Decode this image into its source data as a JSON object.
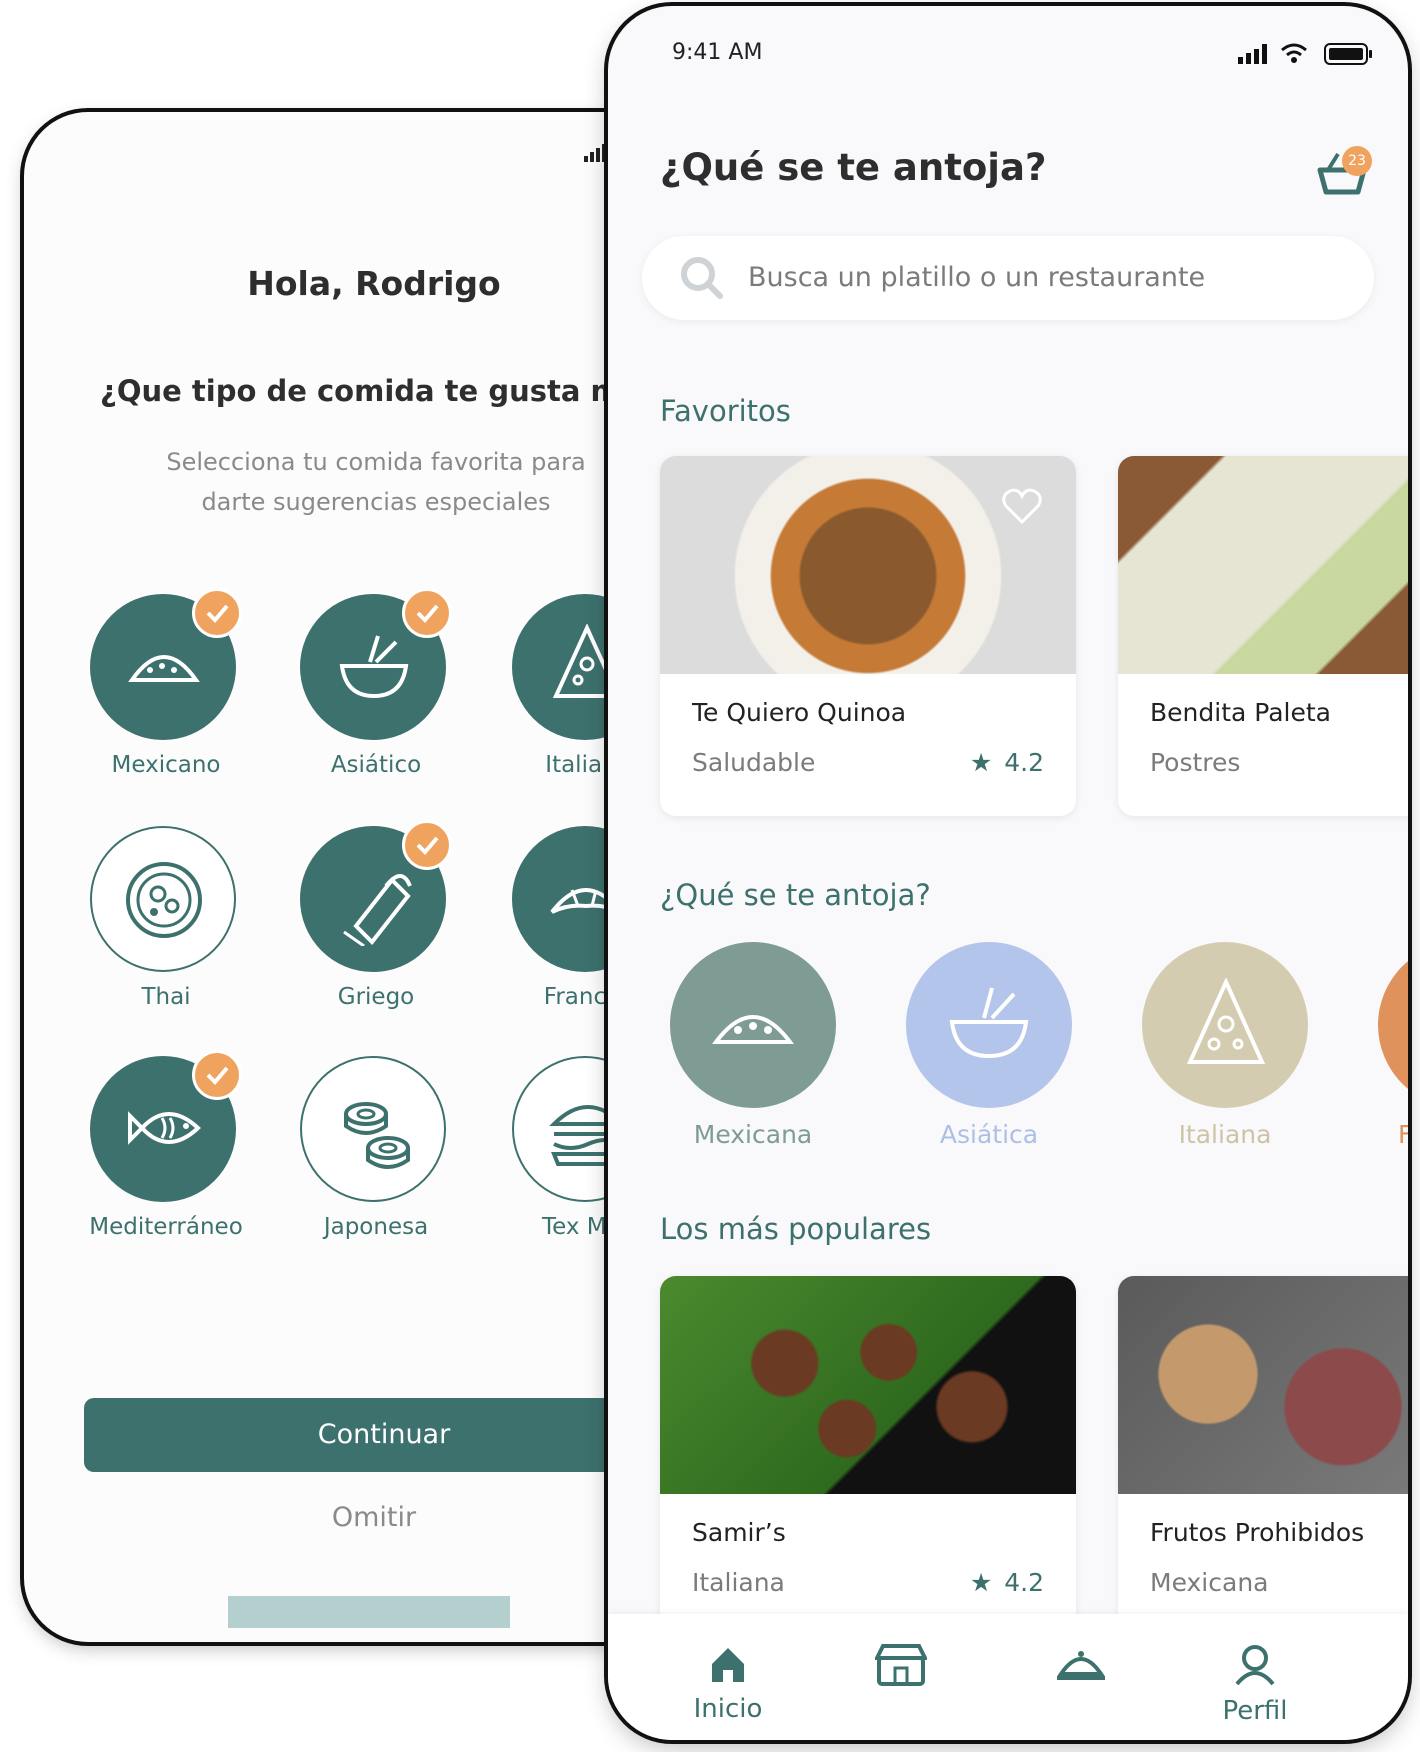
{
  "onboarding": {
    "greeting": "Hola, Rodrigo",
    "question": "¿Que tipo de comida te gusta más?",
    "subtitle_line1": "Selecciona tu comida favorita para",
    "subtitle_line2": "darte sugerencias especiales",
    "categories": [
      {
        "label": "Mexicano",
        "selected": true,
        "icon": "taco-icon"
      },
      {
        "label": "Asiático",
        "selected": true,
        "icon": "bowl-chopsticks-icon"
      },
      {
        "label": "Italiano",
        "selected": false,
        "icon": "pizza-slice-icon"
      },
      {
        "label": "Thai",
        "selected": false,
        "icon": "thai-plate-icon"
      },
      {
        "label": "Griego",
        "selected": true,
        "icon": "gyro-wrap-icon"
      },
      {
        "label": "Francés",
        "selected": false,
        "icon": "croissant-icon"
      },
      {
        "label": "Mediterráneo",
        "selected": true,
        "icon": "fish-icon"
      },
      {
        "label": "Japonesa",
        "selected": false,
        "icon": "sushi-icon"
      },
      {
        "label": "Tex Mex",
        "selected": false,
        "icon": "burger-icon"
      }
    ],
    "continue_label": "Continuar",
    "skip_label": "Omitir"
  },
  "home": {
    "status_time": "9:41 AM",
    "title": "¿Qué se te antoja?",
    "cart_count": "23",
    "search_placeholder": "Busca un platillo o un restaurante",
    "favorites_title": "Favoritos",
    "favorites": [
      {
        "name": "Te Quiero Quinoa",
        "category": "Saludable",
        "rating": "4.2"
      },
      {
        "name": "Bendita Paleta",
        "category": "Postres",
        "rating": ""
      }
    ],
    "cravings_title": "¿Qué se te antoja?",
    "cuisines": [
      {
        "label": "Mexicana",
        "color": "#7f9c94",
        "text_color": "#7f9c94",
        "icon": "taco-icon"
      },
      {
        "label": "Asiática",
        "color": "#b4c5eb",
        "text_color": "#aebfe6",
        "icon": "bowl-chopsticks-icon"
      },
      {
        "label": "Italiana",
        "color": "#d4ccb0",
        "text_color": "#cdc4a6",
        "icon": "pizza-slice-icon"
      },
      {
        "label": "F",
        "color": "#e0925c",
        "text_color": "#e0925c",
        "icon": "food-icon"
      }
    ],
    "popular_title": "Los más populares",
    "popular": [
      {
        "name": "Samir’s",
        "category": "Italiana",
        "rating": "4.2"
      },
      {
        "name": "Frutos Prohibidos",
        "category": "Mexicana",
        "rating": ""
      }
    ],
    "nav": [
      {
        "label": "Inicio",
        "icon": "home-icon"
      },
      {
        "label": "",
        "icon": "store-icon"
      },
      {
        "label": "",
        "icon": "cloche-icon"
      },
      {
        "label": "Perfil",
        "icon": "user-icon"
      }
    ]
  },
  "colors": {
    "teal": "#3d716d",
    "orange": "#f0a35e",
    "light_teal_bar": "#b3d0ce"
  }
}
